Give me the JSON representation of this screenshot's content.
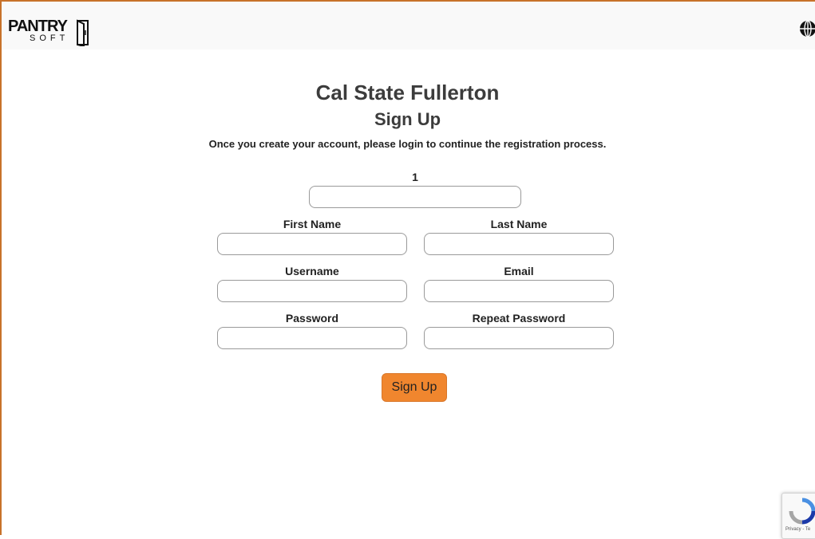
{
  "header": {
    "logo_main": "PANTRY",
    "logo_sub": "SOFT",
    "language_icon": "globe-icon"
  },
  "page": {
    "title": "Cal State Fullerton",
    "subtitle": "Sign Up",
    "note": "Once you create your account, please login to continue the registration process."
  },
  "form": {
    "field_1_label": "1",
    "first_name_label": "First Name",
    "last_name_label": "Last Name",
    "username_label": "Username",
    "email_label": "Email",
    "password_label": "Password",
    "repeat_password_label": "Repeat Password",
    "submit_label": "Sign Up"
  },
  "recaptcha": {
    "text": "Privacy - Te"
  },
  "colors": {
    "accent": "#f0862e",
    "border_accent": "#c8722a"
  }
}
